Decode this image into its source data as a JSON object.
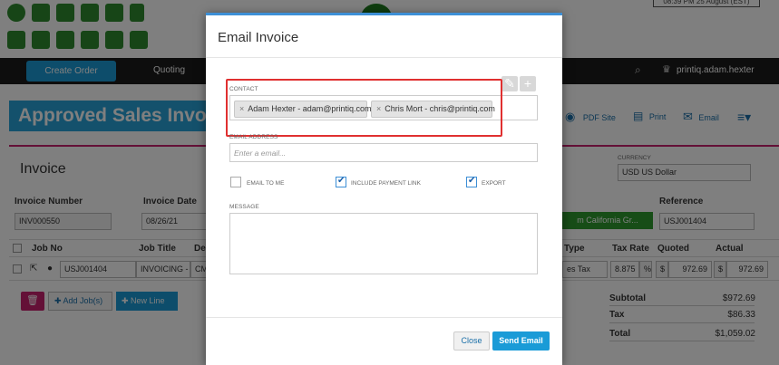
{
  "header": {
    "date_text": "08:39 PM 25 August (EST)",
    "user": "printiq.adam.hexter"
  },
  "nav": {
    "create_order": "Create Order",
    "quoting": "Quoting"
  },
  "page": {
    "title": "Approved Sales Invo",
    "section": "Invoice",
    "tools": {
      "pdf_site": "PDF Site",
      "print": "Print",
      "email": "Email"
    },
    "currency_label": "CURRENCY",
    "currency_value": "USD US Dollar",
    "invoice_number_label": "Invoice Number",
    "invoice_number": "INV000550",
    "invoice_date_label": "Invoice Date",
    "invoice_date": "08/26/21",
    "green_button": "m California Gr...",
    "reference_label": "Reference",
    "reference": "USJ001404"
  },
  "grid": {
    "headers": [
      "Job No",
      "Job Title",
      "De",
      "Type",
      "Tax Rate",
      "Quoted",
      "Actual"
    ],
    "row": {
      "job_no": "USJ001404",
      "job_title": "INVOICING -",
      "desc": "CM",
      "type": "es Tax",
      "tax_rate": "8.875",
      "pct": "%",
      "quoted_cur": "$",
      "quoted": "972.69",
      "actual_cur": "$",
      "actual": "972.69"
    }
  },
  "actions": {
    "add_jobs": "Add Job(s)",
    "new_line": "New Line"
  },
  "totals": {
    "subtotal_label": "Subtotal",
    "subtotal": "$972.69",
    "tax_label": "Tax",
    "tax": "$86.33",
    "total_label": "Total",
    "total": "$1,059.02"
  },
  "modal": {
    "title": "Email Invoice",
    "contact_label": "CONTACT",
    "contacts": [
      {
        "label": "Adam Hexter - adam@printiq.com"
      },
      {
        "label": "Chris Mort - chris@printiq.com"
      }
    ],
    "tag_remove": "×",
    "email_label": "EMAIL ADDRESS",
    "email_placeholder": "Enter a email...",
    "email_value": "",
    "checkboxes": {
      "email_to_me": {
        "label": "EMAIL TO ME",
        "checked": false
      },
      "include_payment_link": {
        "label": "INCLUDE PAYMENT LINK",
        "checked": true
      },
      "export": {
        "label": "EXPORT",
        "checked": true
      }
    },
    "message_label": "MESSAGE",
    "message_value": "",
    "close": "Close",
    "send": "Send Email",
    "highlight_color": "#e03030"
  },
  "colors": {
    "brand_blue": "#1a9bd7",
    "brand_pink": "#c8206f",
    "brand_green": "#2e8b2e",
    "navbar": "#1a1a1a"
  }
}
